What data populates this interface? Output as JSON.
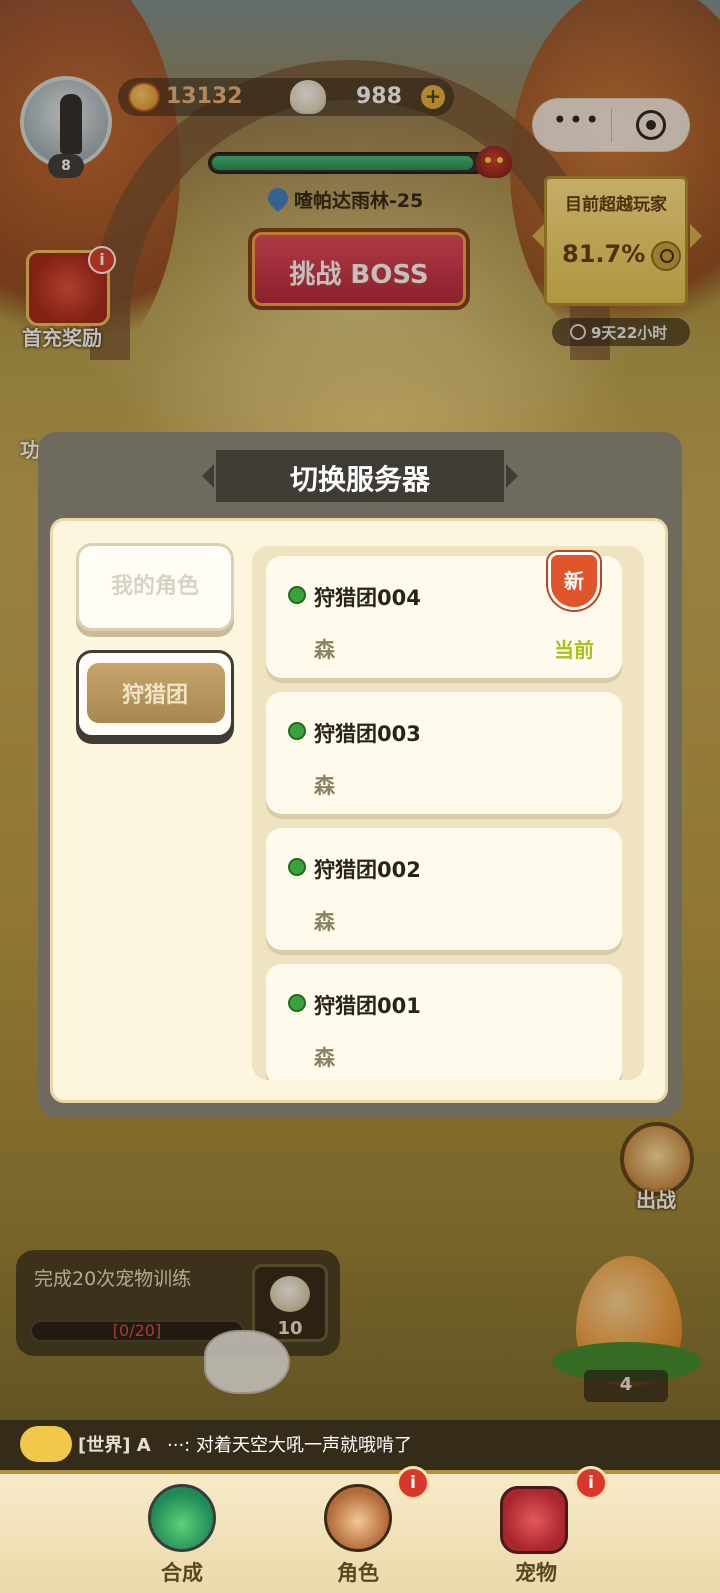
{
  "hud": {
    "level": "8",
    "coins": "13132",
    "pearls": "988",
    "plus_label": "+",
    "more_label": "•••",
    "boss_hp_fraction": 0.96,
    "location": "喳帕达雨林-25",
    "boss_button": "挑战 BOSS",
    "rank": {
      "title": "目前超越玩家",
      "value": "81.7%",
      "timer": "9天22小时"
    },
    "first_charge": {
      "label": "首充奖励",
      "info_glyph": "i"
    },
    "side_label": "功"
  },
  "dialog": {
    "title": "切换服务器",
    "tabs": [
      {
        "label": "我的角色",
        "selected": false
      },
      {
        "label": "狩猎团",
        "selected": true
      }
    ],
    "servers": [
      {
        "name": "狩猎团004",
        "sub": "森",
        "status_color": "#3aa23a",
        "badge": "新",
        "tag": "当前"
      },
      {
        "name": "狩猎团003",
        "sub": "森",
        "status_color": "#3aa23a"
      },
      {
        "name": "狩猎团002",
        "sub": "森",
        "status_color": "#3aa23a"
      },
      {
        "name": "狩猎团001",
        "sub": "森",
        "status_color": "#3aa23a"
      }
    ]
  },
  "fight": {
    "label": "出战"
  },
  "task": {
    "text": "完成20次宠物训练",
    "progress": "[0/20]",
    "progress_fraction": 0,
    "reward_count": "10"
  },
  "egg": {
    "count": "4"
  },
  "chat": {
    "tag": "[世界] A",
    "message": "···: 对着天空大吼一声就哦啃了"
  },
  "nav": {
    "items": [
      {
        "label": "合成",
        "icon": "potion-icon",
        "info": false
      },
      {
        "label": "角色",
        "icon": "character-icon",
        "info": true
      },
      {
        "label": "宠物",
        "icon": "pet-icon",
        "info": true
      }
    ],
    "info_glyph": "i"
  },
  "colors": {
    "accent_red": "#d8382a",
    "status_green": "#3aa23a",
    "current_green": "#a5c21a"
  }
}
